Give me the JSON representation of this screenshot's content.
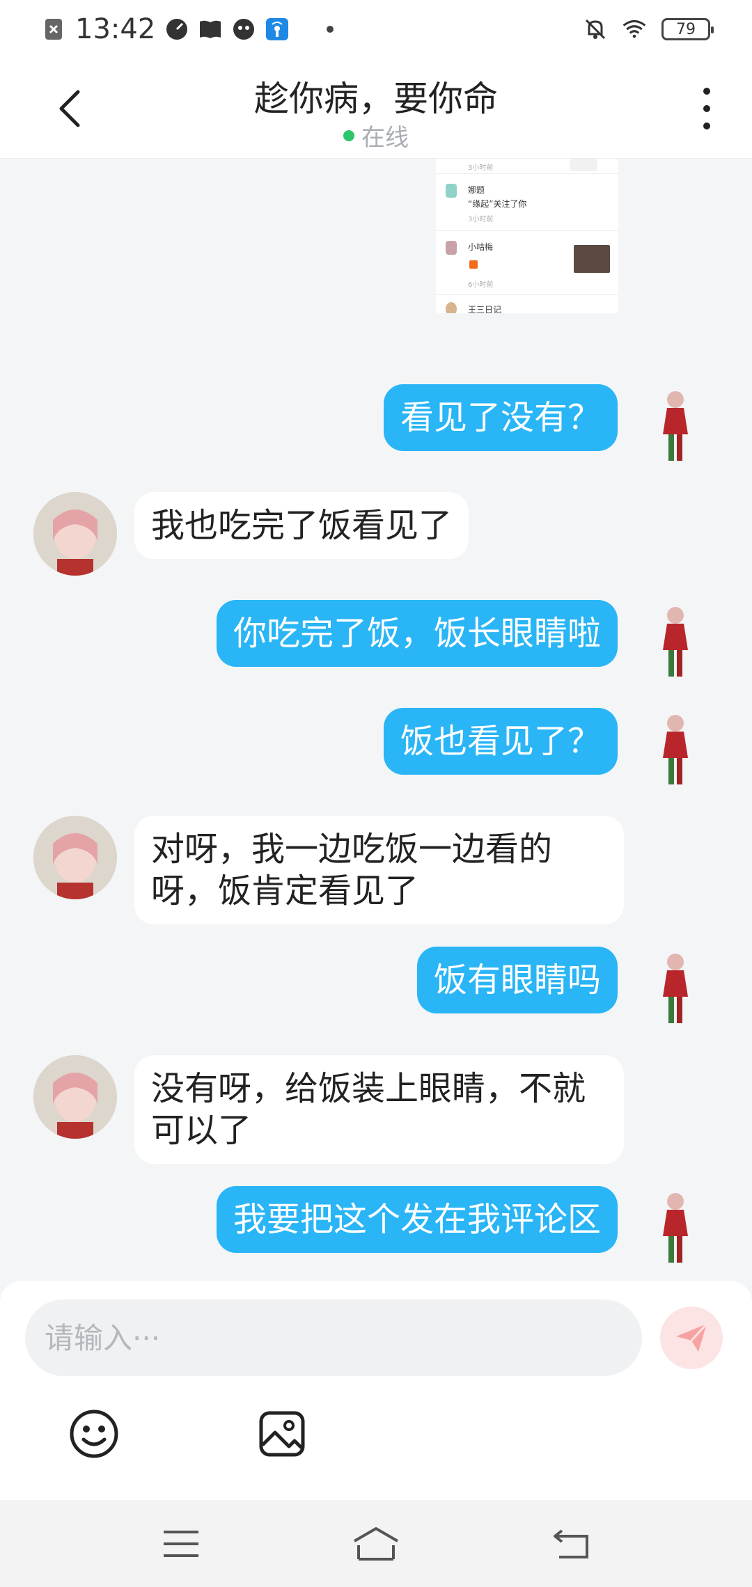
{
  "status_bar": {
    "time": "13:42",
    "battery": "79",
    "icons": [
      "sim-off-icon",
      "gauge-icon",
      "book-icon",
      "ghost-icon",
      "hotspot-icon",
      "mute-icon",
      "wifi-icon",
      "battery-icon"
    ]
  },
  "header": {
    "title": "趁你病，要你命",
    "status": "在线",
    "status_color": "#2dc56a"
  },
  "screenshot_thumb": {
    "rows": [
      {
        "time": "3小时前"
      },
      {
        "name": "娜题",
        "sub": "“缘起”关注了你",
        "time": "3小时前"
      },
      {
        "name": "小咕梅",
        "time": "6小时前"
      },
      {
        "name": "王三日记"
      }
    ]
  },
  "messages": [
    {
      "side": "me",
      "text": "看见了没有？"
    },
    {
      "side": "other",
      "text": "我也吃完了饭看见了"
    },
    {
      "side": "me",
      "text": "你吃完了饭，饭长眼睛啦"
    },
    {
      "side": "me",
      "text": "饭也看见了？"
    },
    {
      "side": "other",
      "text": "对呀，我一边吃饭一边看的呀，饭肯定看见了"
    },
    {
      "side": "me",
      "text": "饭有眼睛吗"
    },
    {
      "side": "other",
      "text": "没有呀，给饭装上眼睛，不就可以了"
    },
    {
      "side": "me",
      "text": "我要把这个发在我评论区"
    }
  ],
  "input": {
    "placeholder": "请输入···",
    "value": ""
  },
  "colors": {
    "my_bubble": "#29b5f6",
    "other_bubble": "#ffffff",
    "background": "#f3f5f7",
    "send_button": "#fde4e4"
  }
}
